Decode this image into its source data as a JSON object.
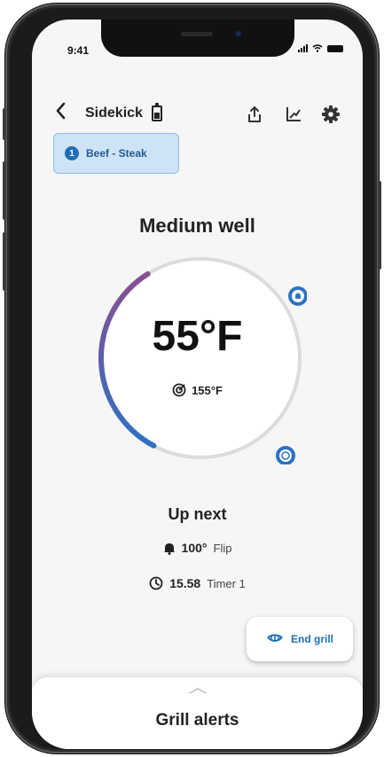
{
  "status_bar": {
    "time": "9:41"
  },
  "header": {
    "title": "Sidekick"
  },
  "probe_chip": {
    "number": "1",
    "label": "Beef - Steak"
  },
  "doneness": "Medium well",
  "current_temp": "55°F",
  "target_temp": "155°F",
  "progress": 0.3,
  "up_next": {
    "title": "Up next",
    "steps": [
      {
        "icon": "bell-icon",
        "value": "100°",
        "label": "Flip"
      },
      {
        "icon": "timer-icon",
        "value": "15.58",
        "label": "Timer 1"
      }
    ]
  },
  "end_grill": {
    "label": "End grill"
  },
  "sheet": {
    "title": "Grill alerts"
  },
  "colors": {
    "accent": "#1f6fb8",
    "arc_start": "#8a4f92",
    "arc_end": "#2c72c2",
    "track": "#dcdcdc"
  }
}
